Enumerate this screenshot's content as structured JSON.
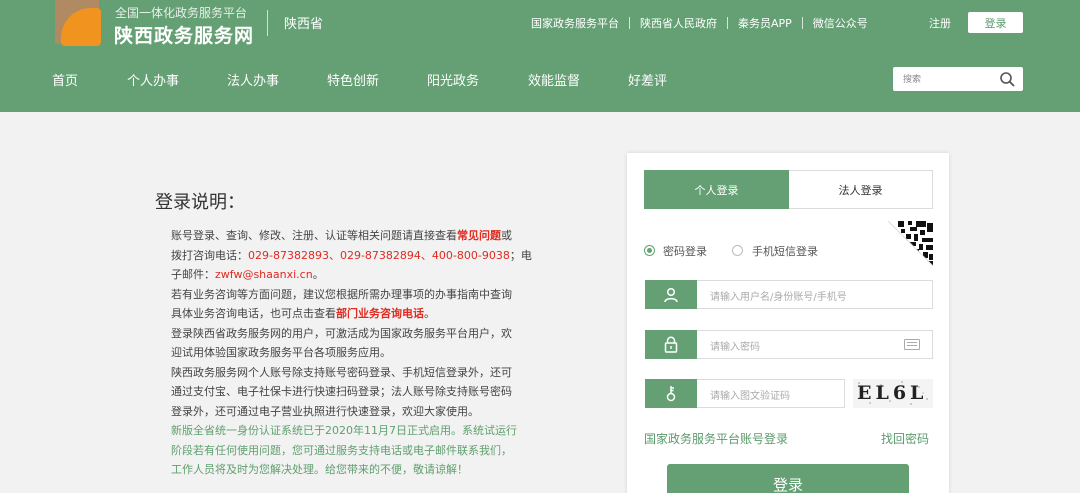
{
  "header": {
    "platform_tag": "全国一体化政务服务平台",
    "site_name": "陕西政务服务网",
    "region": "陕西省",
    "top_links": [
      "国家政务服务平台",
      "陕西省人民政府",
      "秦务员APP",
      "微信公众号"
    ],
    "register_label": "注册",
    "login_label": "登录",
    "nav": [
      "首页",
      "个人办事",
      "法人办事",
      "特色创新",
      "阳光政务",
      "效能监督",
      "好差评"
    ],
    "search_placeholder": "搜索"
  },
  "info": {
    "title": "登录说明：",
    "p1_a": "账号登录、查询、修改、注册、认证等相关问题请直接查看",
    "p1_link": "常见问题",
    "p1_b": "或",
    "p1_c": "拨打咨询电话：",
    "p1_phones": "029-87382893、029-87382894、400-800-9038",
    "p1_d": "；电",
    "p1_e": "子邮件：",
    "p1_email": "zwfw@shaanxi.cn",
    "p1_f": "。",
    "p2_a": "若有业务咨询等方面问题，建议您根据所需办理事项的办事指南中查询",
    "p2_b": "具体业务咨询电话，也可点击查看",
    "p2_link": "部门业务咨询电话",
    "p2_c": "。",
    "p3_a": "登录陕西省政务服务网的用户，可激活成为国家政务服务平台用户，欢",
    "p3_b": "迎试用体验国家政务服务平台各项服务应用。",
    "p4_a": "陕西政务服务网个人账号除支持账号密码登录、手机短信登录外，还可",
    "p4_b": "通过支付宝、电子社保卡进行快速扫码登录；法人账号除支持账号密码",
    "p4_c": "登录外，还可通过电子营业执照进行快速登录，欢迎大家使用。",
    "p5_a": "新版全省统一身份认证系统已于2020年11月7日正式启用。系统试运行",
    "p5_b": "阶段若有任何使用问题，您可通过服务支持电话或电子邮件联系我们，",
    "p5_c": "工作人员将及时为您解决处理。给您带来的不便，敬请谅解！"
  },
  "login": {
    "tab_personal": "个人登录",
    "tab_legal": "法人登录",
    "mode_password": "密码登录",
    "mode_sms": "手机短信登录",
    "username_placeholder": "请输入用户名/身份账号/手机号",
    "password_placeholder": "请输入密码",
    "captcha_placeholder": "请输入图文验证码",
    "captcha_text": "EL6L",
    "national_link": "国家政务服务平台账号登录",
    "retrieve_link": "找回密码",
    "submit": "登录"
  },
  "colors": {
    "brand_green": "#64a074",
    "link_red": "#e02b20",
    "notice_green": "#5fa06e"
  },
  "icons": [
    "logo-mark",
    "search-icon",
    "qr-code-icon",
    "user-icon",
    "lock-icon",
    "key-icon",
    "keyboard-icon"
  ]
}
